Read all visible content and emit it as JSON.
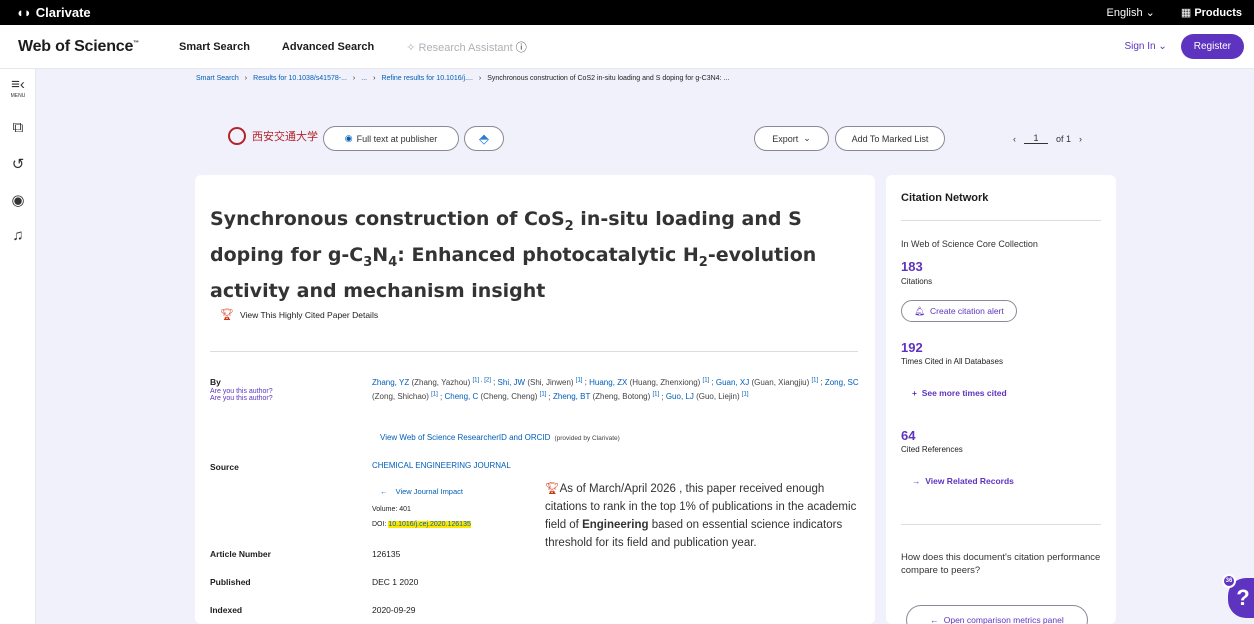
{
  "topbar": {
    "brand": "Clarivate",
    "language": "English ⌄",
    "products": "Products"
  },
  "header": {
    "logo": "Web of Science",
    "logo_tm": "™",
    "nav": [
      "Smart Search",
      "Advanced Search"
    ],
    "research_assistant": "Research Assistant",
    "sign_in": "Sign In ⌄",
    "register": "Register"
  },
  "leftrail": {
    "menu_label": "MENU"
  },
  "breadcrumb": {
    "items": [
      "Smart Search",
      "Results for 10.1038/s41578-...",
      "...",
      "Refine results for 10.1016/j....",
      "Synchronous construction of CoS2 in-situ loading and S doping for g-C3N4: ..."
    ]
  },
  "actions": {
    "logo_text": "西安交通大学",
    "full_text": "Full text at publisher",
    "export": "Export",
    "add_marked": "Add To Marked List",
    "page_current": "1",
    "page_total": "of 1"
  },
  "record": {
    "title_part1": "Synchronous construction of CoS",
    "title_sub1": "2",
    "title_part2": " in-situ loading and S doping for g-C",
    "title_sub2": "3",
    "title_part3": "N",
    "title_sub3": "4",
    "title_part4": ": Enhanced photocatalytic H",
    "title_sub4": "2",
    "title_part5": "-evolution activity and mechanism insight",
    "highly_cited": "View This Highly Cited Paper Details",
    "by_label": "By",
    "are_you_author": "Are you this author?",
    "authors": [
      {
        "short": "Zhang, YZ",
        "full": "(Zhang, Yazhou)",
        "refs": "[1] , [2]"
      },
      {
        "short": "Shi, JW",
        "full": "(Shi, Jinwen)",
        "refs": "[1]"
      },
      {
        "short": "Huang, ZX",
        "full": "(Huang, Zhenxiong)",
        "refs": "[1]"
      },
      {
        "short": "Guan, XJ",
        "full": "(Guan, Xiangjiu)",
        "refs": "[1]"
      },
      {
        "short": "Zong, SC",
        "full": "(Zong, Shichao)",
        "refs": "[1]"
      },
      {
        "short": "Cheng, C",
        "full": "(Cheng, Cheng)",
        "refs": "[1]"
      },
      {
        "short": "Zheng, BT",
        "full": "(Zheng, Botong)",
        "refs": "[1]"
      },
      {
        "short": "Guo, LJ",
        "full": "(Guo, Liejin)",
        "refs": "[1]"
      }
    ],
    "orcid_link": "View Web of Science ResearcherID and ORCID",
    "orcid_provided": "(provided by Clarivate)",
    "source_label": "Source",
    "journal": "CHEMICAL ENGINEERING JOURNAL",
    "journal_impact": "View Journal Impact",
    "volume": "Volume: 401",
    "doi_label": "DOI:",
    "doi": "10.1016/j.cej.2020.126135",
    "article_number_label": "Article Number",
    "article_number": "126135",
    "published_label": "Published",
    "published": "DEC 1 2020",
    "indexed_label": "Indexed",
    "indexed": "2020-09-29",
    "tooltip_part1": "As of March/April 2026 , this paper received enough citations to rank in the top 1% of publications in the academic field of ",
    "tooltip_field": "Engineering",
    "tooltip_part2": " based on essential science indicators threshold for its field and publication year."
  },
  "citation_network": {
    "heading": "Citation Network",
    "collection": "In Web of Science Core Collection",
    "citations": "183",
    "citations_label": "Citations",
    "create_alert": "Create citation alert",
    "times_cited": "192",
    "times_cited_label": "Times Cited in All Databases",
    "see_more": "See more times cited",
    "cited_refs": "64",
    "cited_refs_label": "Cited References",
    "related": "View Related Records",
    "compare_q": "How does this document's citation performance compare to peers?",
    "compare_btn": "Open comparison metrics panel"
  },
  "help": {
    "badge": "36",
    "label": "?"
  },
  "colors": {
    "accent": "#5e33bf",
    "link": "#005eb8",
    "highlight": "#ffe600",
    "trophy": "#d1330e"
  }
}
